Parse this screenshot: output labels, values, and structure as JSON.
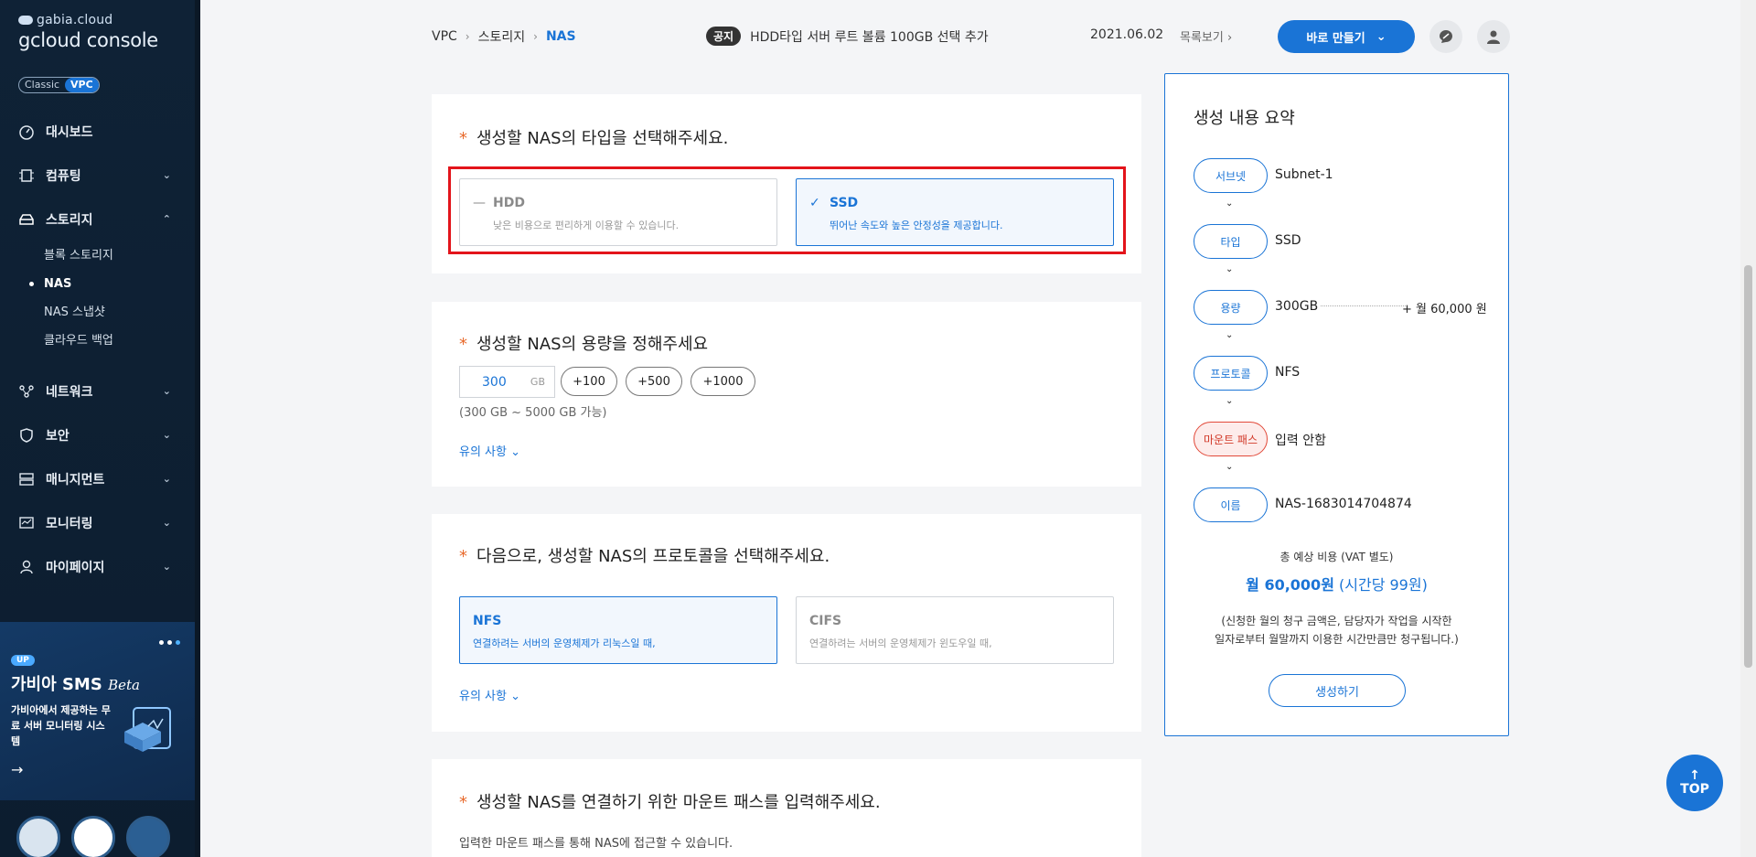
{
  "sidebar": {
    "logo_top": "gabia.cloud",
    "logo_main": "gcloud console",
    "toggle": {
      "classic": "Classic",
      "vpc": "VPC"
    },
    "menu": [
      {
        "label": "대시보드",
        "icon": "dashboard-icon"
      },
      {
        "label": "컴퓨팅",
        "icon": "chip-icon"
      },
      {
        "label": "스토리지",
        "icon": "storage-icon",
        "open": true,
        "children": [
          "블록 스토리지",
          "NAS",
          "NAS 스냅샷",
          "클라우드 백업"
        ]
      },
      {
        "label": "네트워크",
        "icon": "network-icon"
      },
      {
        "label": "보안",
        "icon": "shield-icon"
      },
      {
        "label": "매니지먼트",
        "icon": "management-icon"
      },
      {
        "label": "모니터링",
        "icon": "monitor-icon"
      },
      {
        "label": "마이페이지",
        "icon": "user-icon"
      }
    ],
    "promo": {
      "tag": "UP",
      "title": "가비아 SMS",
      "title_em": "Beta",
      "desc": "가비아에서 제공하는 무료 서버 모니터링 시스템"
    }
  },
  "header": {
    "breadcrumb": [
      "VPC",
      "스토리지",
      "NAS"
    ],
    "notice_tag": "공지",
    "notice_text": "HDD타입 서버 루트 볼륨 100GB 선택 추가",
    "notice_date": "2021.06.02",
    "notice_more": "목록보기",
    "create_btn": "바로 만들기"
  },
  "type_section": {
    "title": "생성할 NAS의 타입을 선택해주세요.",
    "options": [
      {
        "name": "HDD",
        "desc": "낮은 비용으로 편리하게 이용할 수 있습니다.",
        "selected": false
      },
      {
        "name": "SSD",
        "desc": "뛰어난 속도와 높은 안정성을 제공합니다.",
        "selected": true
      }
    ]
  },
  "size_section": {
    "title": "생성할 NAS의 용량을 정해주세요",
    "value": "300",
    "unit": "GB",
    "increments": [
      "+100",
      "+500",
      "+1000"
    ],
    "range": "(300 GB ~ 5000 GB 가능)",
    "note": "유의 사항"
  },
  "protocol_section": {
    "title": "다음으로, 생성할 NAS의 프로토콜을 선택해주세요.",
    "options": [
      {
        "name": "NFS",
        "desc": "연결하려는 서버의 운영체제가 리눅스일 때,",
        "selected": true
      },
      {
        "name": "CIFS",
        "desc": "연결하려는 서버의 운영체제가 윈도우일 때,",
        "selected": false
      }
    ],
    "note": "유의 사항"
  },
  "mount_section": {
    "title": "생성할 NAS를 연결하기 위한 마운트 패스를 입력해주세요.",
    "desc": "입력한 마운트 패스를 통해 NAS에 접근할 수 있습니다."
  },
  "summary": {
    "title": "생성 내용 요약",
    "steps": [
      {
        "label": "서브넷",
        "value": "Subnet-1"
      },
      {
        "label": "타입",
        "value": "SSD"
      },
      {
        "label": "용량",
        "value": "300GB",
        "price": "+ 월 60,000 원"
      },
      {
        "label": "프로토콜",
        "value": "NFS"
      },
      {
        "label": "마운트 패스",
        "value": "입력 안함",
        "warn": true
      },
      {
        "label": "이름",
        "value": "NAS-1683014704874"
      }
    ],
    "total_label": "총 예상 비용 (VAT 별도)",
    "total_main": "월 60,000원",
    "total_sub": "(시간당 99원)",
    "note_line1": "(신청한 월의 청구 금액은, 담당자가 작업을 시작한",
    "note_line2": "일자로부터 월말까지 이용한 시간만큼만 청구됩니다.)",
    "make_btn": "생성하기"
  },
  "top_btn": "TOP",
  "colors": {
    "accent": "#1a74d6",
    "warn": "#e24a3a",
    "highlight": "#e3141b"
  }
}
